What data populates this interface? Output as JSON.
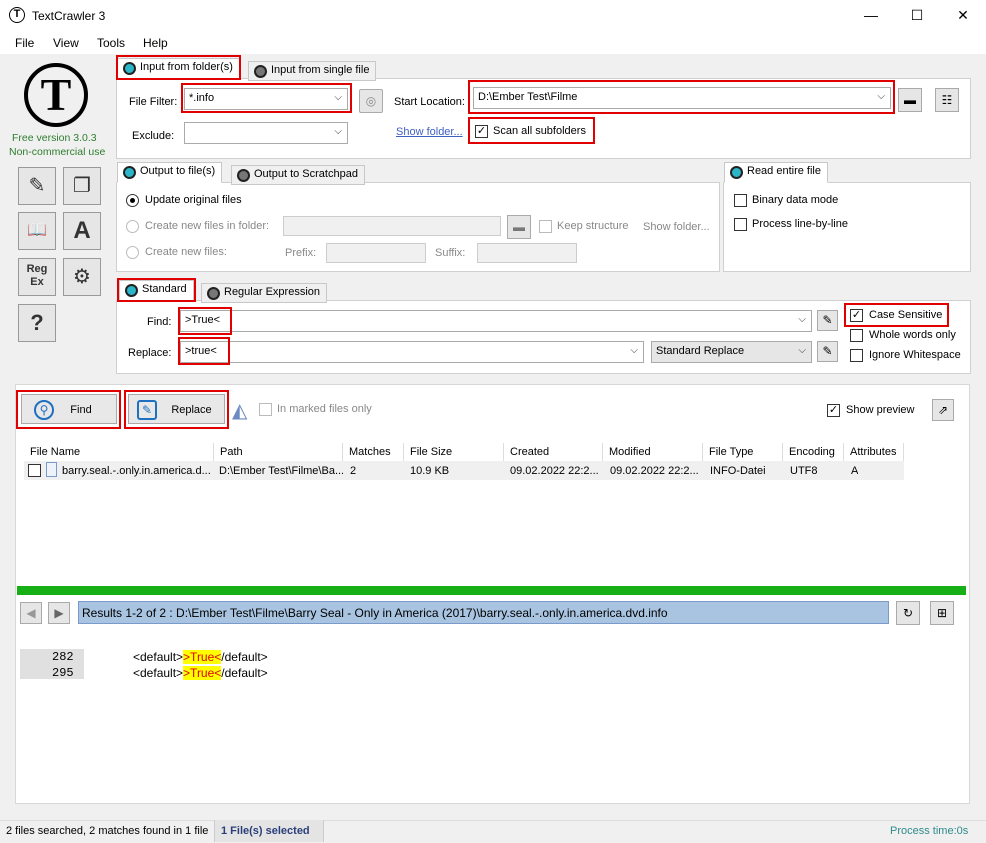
{
  "window": {
    "title": "TextCrawler 3",
    "minimize": "—",
    "maximize": "☐",
    "close": "✕"
  },
  "menu": [
    "File",
    "View",
    "Tools",
    "Help"
  ],
  "logo": {
    "letter": "T",
    "version": "Free version 3.0.3",
    "license": "Non-commercial use"
  },
  "side_tiles": [
    "✎",
    "❐",
    "📖",
    "A",
    "Reg\nEx",
    "⚙",
    "?"
  ],
  "input_tabs": {
    "folder": "Input from folder(s)",
    "single": "Input from single file"
  },
  "file_filter": {
    "label": "File Filter:",
    "value": "*.info"
  },
  "exclude": {
    "label": "Exclude:",
    "value": ""
  },
  "start_location": {
    "label": "Start Location:",
    "value": "D:\\Ember Test\\Filme"
  },
  "show_folder": "Show folder...",
  "scan_subfolders": {
    "label": "Scan all subfolders",
    "checked": true
  },
  "output_tabs": {
    "files": "Output to file(s)",
    "scratchpad": "Output to Scratchpad"
  },
  "output_options": {
    "update": "Update original files",
    "create_folder": "Create new files in folder:",
    "keep_structure": "Keep structure",
    "show_folder": "Show folder...",
    "create_files": "Create new files:",
    "prefix": "Prefix:",
    "suffix": "Suffix:"
  },
  "read_tab": "Read entire file",
  "read_options": {
    "binary": "Binary data mode",
    "line": "Process line-by-line"
  },
  "search_tabs": {
    "standard": "Standard",
    "regex": "Regular Expression"
  },
  "find": {
    "label": "Find:",
    "value": ">True<"
  },
  "replace": {
    "label": "Replace:",
    "value": ">true<",
    "mode": "Standard Replace"
  },
  "options": {
    "case": "Case Sensitive",
    "whole": "Whole words only",
    "ignore_ws": "Ignore Whitespace",
    "case_checked": true
  },
  "actions": {
    "find": "Find",
    "replace": "Replace",
    "marked": "In marked files only",
    "preview": "Show preview"
  },
  "columns": [
    "File Name",
    "Path",
    "Matches",
    "File Size",
    "Created",
    "Modified",
    "File Type",
    "Encoding",
    "Attributes"
  ],
  "rows": [
    {
      "name": "barry.seal.-.only.in.america.d...",
      "path": "D:\\Ember Test\\Filme\\Ba...",
      "matches": "2",
      "size": "10.9 KB",
      "created": "09.02.2022 22:2...",
      "modified": "09.02.2022 22:2...",
      "type": "INFO-Datei",
      "encoding": "UTF8",
      "attributes": "A"
    }
  ],
  "progress": 1.0,
  "results_bar": "Results 1-2 of 2 : D:\\Ember Test\\Filme\\Barry Seal - Only in America (2017)\\barry.seal.-.only.in.america.dvd.info",
  "preview_lines": [
    {
      "num": "282",
      "pre": "<default>",
      "match": ">True<",
      "post": "/default>"
    },
    {
      "num": "295",
      "pre": "<default>",
      "match": ">True<",
      "post": "/default>"
    }
  ],
  "status": {
    "searched": "2 files searched, 2 matches found in 1 file",
    "selected": "1 File(s) selected",
    "time": "Process time:0s"
  },
  "colors": {
    "accent": "#2ab5c8",
    "highlight_red": "#e00000",
    "progress_green": "#16b016",
    "results_blue": "#a8c4e0"
  }
}
